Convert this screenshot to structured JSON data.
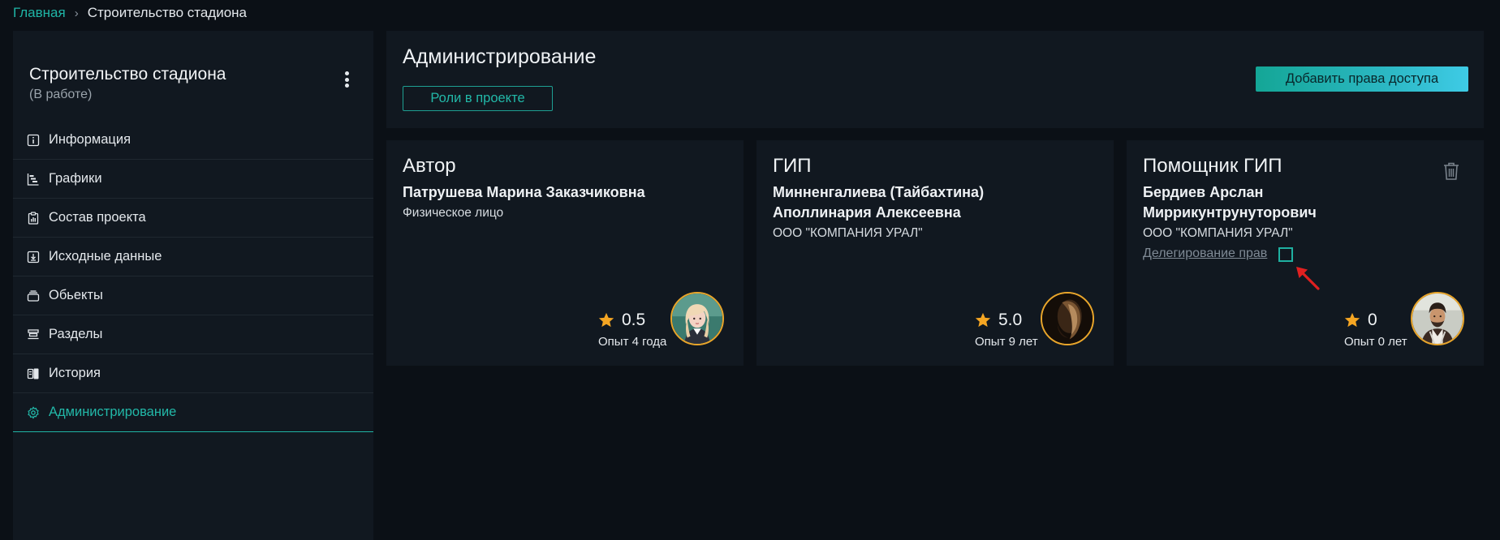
{
  "breadcrumb": {
    "home": "Главная",
    "separator": "›",
    "current": "Строительство стадиона"
  },
  "sidebar": {
    "project_title": "Строительство стадиона",
    "project_status": "(В работе)",
    "items": [
      {
        "label": "Информация",
        "icon": "info-icon"
      },
      {
        "label": "Графики",
        "icon": "gantt-chart-icon"
      },
      {
        "label": "Состав проекта",
        "icon": "clipboard-chart-icon"
      },
      {
        "label": "Исходные данные",
        "icon": "download-box-icon"
      },
      {
        "label": "Обьекты",
        "icon": "layers-box-icon"
      },
      {
        "label": "Разделы",
        "icon": "sections-icon"
      },
      {
        "label": "История",
        "icon": "history-devices-icon"
      },
      {
        "label": "Администрирование",
        "icon": "gear-icon",
        "active": true
      }
    ]
  },
  "header": {
    "title": "Администрирование",
    "roles_button": "Роли в проекте",
    "add_button": "Добавить права доступа"
  },
  "cards": [
    {
      "role": "Автор",
      "name": "Патрушева Марина Заказчиковна",
      "org": "Физическое лицо",
      "rating": "0.5",
      "experience": "Опыт 4 года"
    },
    {
      "role": "ГИП",
      "name": "Минненгалиева (Тайбахтина) Аполлинария Алексеевна",
      "org": "ООО \"КОМПАНИЯ УРАЛ\"",
      "rating": "5.0",
      "experience": "Опыт 9 лет"
    },
    {
      "role": "Помощник ГИП",
      "name": "Бердиев Арслан Миррикунтрунуторович",
      "org": "ООО \"КОМПАНИЯ УРАЛ\"",
      "rating": "0",
      "experience": "Опыт 0 лет",
      "delegation_label": "Делегирование прав",
      "delegation_checked": false
    }
  ],
  "colors": {
    "accent": "#1fb5a6",
    "background": "#0b1016",
    "panel": "#111820",
    "star": "#f5a623",
    "avatar_ring": "#e9a52a",
    "pointer_arrow": "#e02020"
  }
}
